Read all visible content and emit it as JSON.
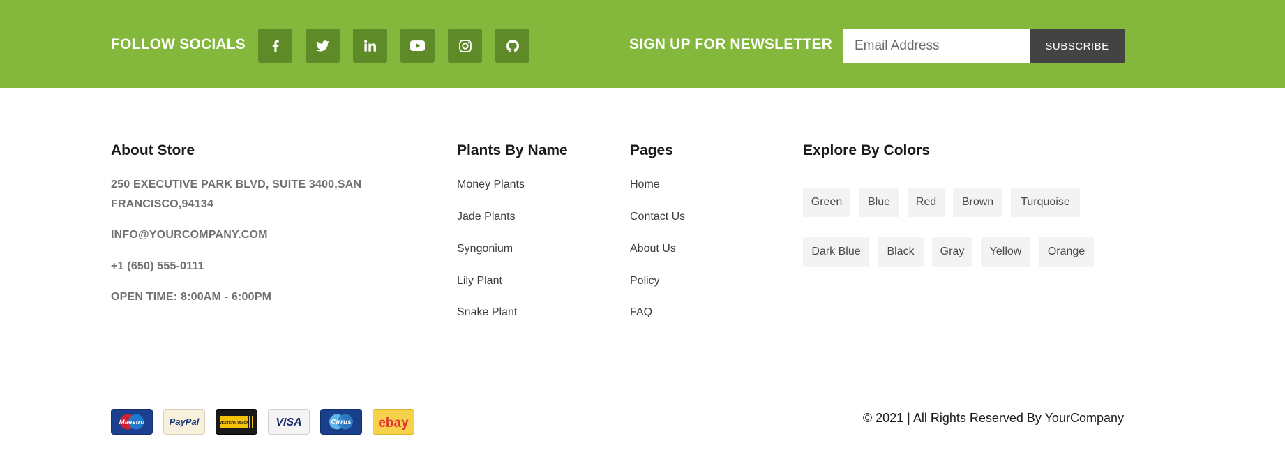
{
  "socials": {
    "label": "FOLLOW SOCIALS",
    "icons": [
      "facebook-icon",
      "twitter-icon",
      "linkedin-icon",
      "youtube-icon",
      "instagram-icon",
      "github-icon"
    ]
  },
  "newsletter": {
    "label": "SIGN UP FOR NEWSLETTER",
    "placeholder": "Email Address",
    "button": "SUBSCRIBE"
  },
  "about": {
    "title": "About Store",
    "address_line1": "250 EXECUTIVE PARK BLVD, SUITE 3400,SAN",
    "address_line2": "FRANCISCO,94134",
    "email": "INFO@YOURCOMPANY.COM",
    "phone": "+1 (650) 555-0111",
    "hours": "OPEN TIME: 8:00AM - 6:00PM"
  },
  "plants": {
    "title": "Plants By Name",
    "items": [
      "Money Plants",
      "Jade Plants",
      "Syngonium",
      "Lily Plant",
      "Snake Plant"
    ]
  },
  "pages": {
    "title": "Pages",
    "items": [
      "Home",
      "Contact Us",
      "About Us",
      "Policy",
      "FAQ"
    ]
  },
  "colors": {
    "title": "Explore By Colors",
    "row1": [
      "Green",
      "Blue",
      "Red",
      "Brown",
      "Turquoise"
    ],
    "row2": [
      "Dark Blue",
      "Black",
      "Gray",
      "Yellow",
      "Orange"
    ]
  },
  "payments": {
    "cards": [
      "Maestro",
      "PayPal",
      "WESTERN UNION",
      "VISA",
      "Cirrus",
      "ebay"
    ]
  },
  "footer": {
    "copyright": "© 2021 | All Rights Reserved By YourCompany"
  },
  "theme": {
    "accent": "#84b83c",
    "social_bg": "#5f8a28",
    "button_dark": "#434343"
  }
}
